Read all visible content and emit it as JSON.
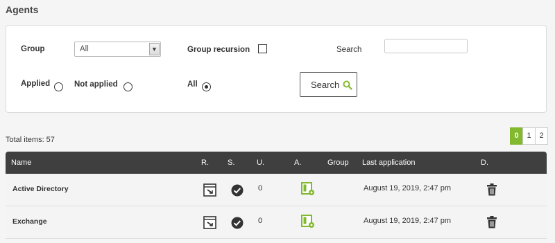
{
  "page": {
    "title": "Agents"
  },
  "filters": {
    "group_label": "Group",
    "group_value": "All",
    "group_recursion_label": "Group recursion",
    "group_recursion_checked": false,
    "search_label": "Search",
    "search_value": "",
    "applied_label": "Applied",
    "not_applied_label": "Not applied",
    "all_label": "All",
    "selected_radio": "all",
    "search_button_label": "Search"
  },
  "summary": {
    "total_items": "Total items: 57"
  },
  "pagination": {
    "pages": [
      "0",
      "1",
      "2"
    ],
    "current": "0"
  },
  "table": {
    "headers": {
      "name": "Name",
      "r": "R.",
      "s": "S.",
      "u": "U.",
      "a": "A.",
      "group": "Group",
      "last_application": "Last application",
      "d": "D."
    },
    "rows": [
      {
        "name": "Active Directory",
        "u": "0",
        "group": "",
        "last_application": "August 19, 2019, 2:47 pm"
      },
      {
        "name": "Exchange",
        "u": "0",
        "group": "",
        "last_application": "August 19, 2019, 2:47 pm"
      }
    ]
  },
  "colors": {
    "accent": "#82b92e",
    "header_bg": "#3f3f3f"
  }
}
